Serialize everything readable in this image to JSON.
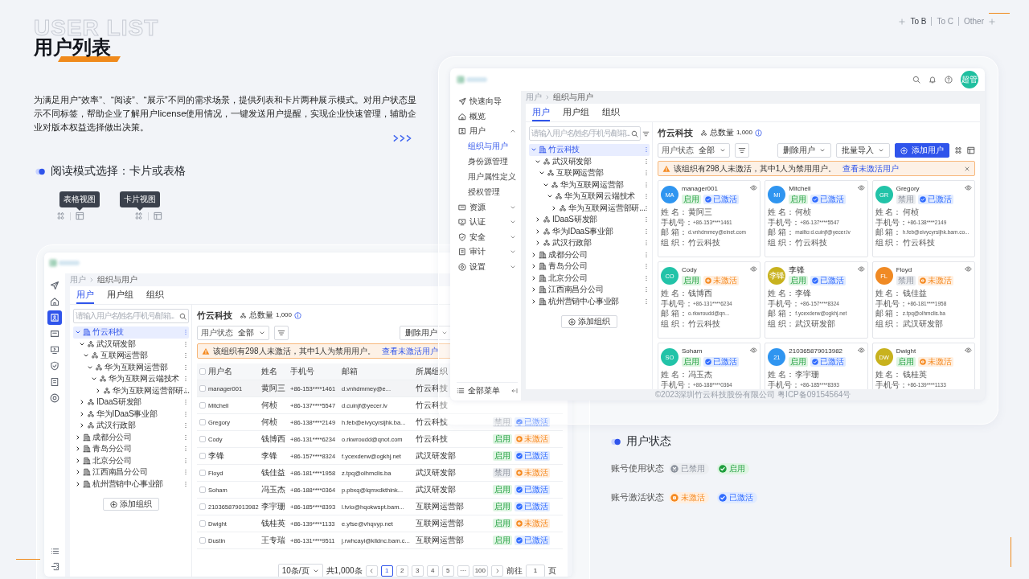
{
  "intro": {
    "title_en": "USER LIST",
    "title": "用户列表",
    "description": "为满足用户“效率”、“阅读”、“展示”不同的需求场景，提供列表和卡片两种展示模式。对用户状态显示不同标签，帮助企业了解用户license使用情况，一键发送用户提醒，实现企业快速管理，辅助企业对版本权益选择做出决策。",
    "nav": [
      {
        "label": "To B",
        "selected": true
      },
      {
        "label": "To C",
        "selected": false
      },
      {
        "label": "Other",
        "selected": false
      }
    ]
  },
  "reading_mode": {
    "heading": "阅读模式选择：卡片或表格",
    "demos": [
      {
        "tooltip": "表格视图",
        "kind": "table"
      },
      {
        "tooltip": "卡片视图",
        "kind": "grid"
      }
    ]
  },
  "table_app": {
    "rail": [
      {
        "selected": false
      },
      {
        "selected": false
      },
      {
        "selected": true
      },
      {
        "selected": false
      },
      {
        "selected": false
      },
      {
        "selected": false
      },
      {
        "selected": false
      },
      {
        "selected": false
      }
    ],
    "breadcrumb": [
      "用户",
      "组织与用户"
    ],
    "tabs": [
      {
        "label": "用户",
        "selected": true
      },
      {
        "label": "用户组",
        "selected": false
      },
      {
        "label": "组织",
        "selected": false
      }
    ],
    "search": {
      "placeholder": "请输入用户名/姓名/手机号/邮箱..."
    },
    "tree": [
      {
        "label": "竹云科技",
        "kind": "company",
        "expanded": true,
        "selected": true,
        "children": [
          {
            "label": "武汉研发部",
            "kind": "dept",
            "expanded": true,
            "selected": false,
            "children": [
              {
                "label": "互联网运营部",
                "kind": "dept",
                "expanded": true,
                "selected": false,
                "children": [
                  {
                    "label": "华为互联网运营部",
                    "kind": "dept",
                    "expanded": true,
                    "selected": false,
                    "children": [
                      {
                        "label": "华为互联网云端技术",
                        "kind": "dept",
                        "expanded": true,
                        "selected": false,
                        "children": [
                          {
                            "label": "华为互联网运营部研...",
                            "kind": "dept",
                            "expanded": false,
                            "selected": false
                          }
                        ]
                      }
                    ]
                  }
                ]
              }
            ]
          },
          {
            "label": "IDaaS研发部",
            "kind": "dept",
            "expanded": false,
            "selected": false
          },
          {
            "label": "华为IDaaS事业部",
            "kind": "dept",
            "expanded": false,
            "selected": false
          },
          {
            "label": "武汉行政部",
            "kind": "dept",
            "expanded": false,
            "selected": false
          }
        ]
      },
      {
        "label": "成都分公司",
        "kind": "company",
        "expanded": false,
        "selected": false
      },
      {
        "label": "青岛分公司",
        "kind": "company",
        "expanded": false,
        "selected": false
      },
      {
        "label": "北京分公司",
        "kind": "company",
        "expanded": false,
        "selected": false
      },
      {
        "label": "江西南昌分公司",
        "kind": "company",
        "expanded": false,
        "selected": false
      },
      {
        "label": "杭州营销中心事业部",
        "kind": "company",
        "expanded": false,
        "selected": false
      }
    ],
    "add_org": "添加组织",
    "org_title": "竹云科技",
    "count_label": "总数量",
    "count": "1,000",
    "filter": {
      "label": "用户状态",
      "value": "全部"
    },
    "buttons": [
      {
        "label": "删除用户",
        "kind": "dropdown"
      }
    ],
    "alert": {
      "text": "该组织有298人未激活，其中1人为禁用用户。",
      "link": "查看未激活用户"
    },
    "columns": [
      "用户名",
      "姓名",
      "手机号",
      "邮箱",
      "所属组织"
    ],
    "header_checked": false,
    "rows": [
      {
        "checked": false,
        "highlighted": true,
        "cells": [
          "manager001",
          "黄阿三",
          "+86-153****1461",
          "d.vnhdmmey@e...",
          "竹云科技"
        ]
      },
      {
        "checked": false,
        "highlighted": false,
        "cells": [
          "Mitchell",
          "何桢",
          "+86-137****5547",
          "d.cuinjf@yecer.lv",
          "竹云科技"
        ]
      },
      {
        "checked": false,
        "highlighted": false,
        "cells": [
          "Gregory",
          "何桢",
          "+86-138****2149",
          "h.feb@eivycyrsijhk.ba...",
          "竹云科技"
        ],
        "tags": [
          {
            "kind": "disabled",
            "label": "禁用"
          },
          {
            "kind": "active",
            "label": "已激活"
          }
        ]
      },
      {
        "checked": false,
        "highlighted": false,
        "cells": [
          "Cody",
          "钱博西",
          "+86-131****6234",
          "o.rkwroudd@qnot.com",
          "竹云科技"
        ],
        "tags": [
          {
            "kind": "enabled",
            "label": "启用"
          },
          {
            "kind": "inactive",
            "label": "未激活"
          }
        ]
      },
      {
        "checked": false,
        "highlighted": false,
        "cells": [
          "李锋",
          "李锋",
          "+86-157****8324",
          "f.ycexderw@ogkhj.net",
          "武汉研发部"
        ],
        "tags": [
          {
            "kind": "enabled",
            "label": "启用"
          },
          {
            "kind": "active",
            "label": "已激活"
          }
        ]
      },
      {
        "checked": false,
        "highlighted": false,
        "cells": [
          "Floyd",
          "钱佳益",
          "+86-181****1958",
          "z.tpq@olhmclis.ba",
          "武汉研发部"
        ],
        "tags": [
          {
            "kind": "disabled",
            "label": "禁用"
          },
          {
            "kind": "inactive",
            "label": "未激活"
          }
        ]
      },
      {
        "checked": false,
        "highlighted": false,
        "cells": [
          "Soham",
          "冯玉杰",
          "+86-188****0364",
          "p.pbxq@lqmxdkthink...",
          "武汉研发部"
        ],
        "tags": [
          {
            "kind": "enabled",
            "label": "启用"
          },
          {
            "kind": "active",
            "label": "已激活"
          }
        ]
      },
      {
        "checked": false,
        "highlighted": false,
        "cells": [
          "210365879013982",
          "李宇珊",
          "+86-185****8393",
          "l.tvio@hqokwspt.bam...",
          "互联网运营部"
        ],
        "tags": [
          {
            "kind": "enabled",
            "label": "启用"
          },
          {
            "kind": "active",
            "label": "已激活"
          }
        ]
      },
      {
        "checked": false,
        "highlighted": false,
        "cells": [
          "Dwight",
          "钱桂英",
          "+86-139****1133",
          "e.yfse@vhqvyp.net",
          "互联网运营部"
        ],
        "tags": [
          {
            "kind": "enabled",
            "label": "启用"
          },
          {
            "kind": "inactive",
            "label": "未激活"
          }
        ]
      },
      {
        "checked": false,
        "highlighted": false,
        "cells": [
          "Dustin",
          "王专瑞",
          "+86-131****9511",
          "j.rwhcayi@klldnc.bam.c...",
          "互联网运营部"
        ],
        "tags": [
          {
            "kind": "enabled",
            "label": "启用"
          },
          {
            "kind": "active",
            "label": "已激活"
          }
        ]
      }
    ],
    "pagination": {
      "page_size": "10条/页",
      "total": "共1,000条",
      "pages": [
        {
          "label": "1",
          "selected": true
        },
        {
          "label": "2",
          "selected": false
        },
        {
          "label": "3",
          "selected": false
        },
        {
          "label": "4",
          "selected": false
        },
        {
          "label": "5",
          "selected": false
        },
        {
          "label": "···",
          "selected": false
        },
        {
          "label": "100",
          "selected": false
        }
      ],
      "goto_label": "前往",
      "goto_value": "1",
      "goto_unit": "页"
    }
  },
  "card_app": {
    "avatar": "超管",
    "sidebar": {
      "items": [
        {
          "label": "快速向导",
          "selected": false
        },
        {
          "label": "概览",
          "selected": false
        },
        {
          "label": "用户",
          "selected": false,
          "expanded": true,
          "children": [
            {
              "label": "组织与用户",
              "selected": true
            },
            {
              "label": "身份源管理",
              "selected": false
            },
            {
              "label": "用户属性定义",
              "selected": false
            },
            {
              "label": "授权管理",
              "selected": false
            }
          ]
        },
        {
          "label": "资源",
          "selected": false,
          "expanded": false
        },
        {
          "label": "认证",
          "selected": false,
          "expanded": false
        },
        {
          "label": "安全",
          "selected": false,
          "expanded": false
        },
        {
          "label": "审计",
          "selected": false,
          "expanded": false
        },
        {
          "label": "设置",
          "selected": false,
          "expanded": false
        }
      ],
      "footer": "全部菜单"
    },
    "breadcrumb": [
      "用户",
      "组织与用户"
    ],
    "tabs": [
      {
        "label": "用户",
        "selected": true
      },
      {
        "label": "用户组",
        "selected": false
      },
      {
        "label": "组织",
        "selected": false
      }
    ],
    "search": {
      "placeholder": "请输入用户名/姓名/手机号/邮箱..."
    },
    "tree": [
      {
        "label": "竹云科技",
        "kind": "company",
        "expanded": true,
        "selected": true,
        "children": [
          {
            "label": "武汉研发部",
            "kind": "dept",
            "expanded": true,
            "selected": false,
            "children": [
              {
                "label": "互联网运营部",
                "kind": "dept",
                "expanded": true,
                "selected": false,
                "children": [
                  {
                    "label": "华为互联网运营部",
                    "kind": "dept",
                    "expanded": true,
                    "selected": false,
                    "children": [
                      {
                        "label": "华为互联网云端技术",
                        "kind": "dept",
                        "expanded": true,
                        "selected": false,
                        "children": [
                          {
                            "label": "华为互联网运营部研...",
                            "kind": "dept",
                            "expanded": false,
                            "selected": false
                          }
                        ]
                      }
                    ]
                  }
                ]
              }
            ]
          },
          {
            "label": "IDaaS研发部",
            "kind": "dept",
            "expanded": false,
            "selected": false
          },
          {
            "label": "华为IDaaS事业部",
            "kind": "dept",
            "expanded": false,
            "selected": false
          },
          {
            "label": "武汉行政部",
            "kind": "dept",
            "expanded": false,
            "selected": false
          }
        ]
      },
      {
        "label": "成都分公司",
        "kind": "company",
        "expanded": false,
        "selected": false
      },
      {
        "label": "青岛分公司",
        "kind": "company",
        "expanded": false,
        "selected": false
      },
      {
        "label": "北京分公司",
        "kind": "company",
        "expanded": false,
        "selected": false
      },
      {
        "label": "江西南昌分公司",
        "kind": "company",
        "expanded": false,
        "selected": false
      },
      {
        "label": "杭州营销中心事业部",
        "kind": "company",
        "expanded": false,
        "selected": false
      }
    ],
    "add_org": "添加组织",
    "org_title": "竹云科技",
    "count_label": "总数量",
    "count": "1,000",
    "filter": {
      "label": "用户状态",
      "value": "全部"
    },
    "buttons": [
      {
        "label": "删除用户",
        "kind": "dropdown"
      },
      {
        "label": "批量导入",
        "kind": "dropdown"
      },
      {
        "label": "添加用户",
        "kind": "primary"
      }
    ],
    "alert": {
      "text": "该组织有298人未激活，其中1人为禁用用户。",
      "link": "查看未激活用户",
      "closable": true
    },
    "cards": [
      {
        "initials": "MA",
        "color": "#2f95f0",
        "name": "manager001",
        "tags": [
          {
            "kind": "enabled",
            "label": "启用"
          },
          {
            "kind": "active",
            "label": "已激活"
          }
        ],
        "fields": [
          {
            "label": "姓 名：",
            "value": "黄阿三"
          },
          {
            "label": "手机号：",
            "value": "+86-153****1461"
          },
          {
            "label": "邮 箱：",
            "value": "d.vnhdmmey@einet.com"
          },
          {
            "label": "组 织：",
            "value": "竹云科技"
          }
        ]
      },
      {
        "initials": "MI",
        "color": "#2f95f0",
        "name": "Mitchell",
        "tags": [
          {
            "kind": "enabled",
            "label": "启用"
          },
          {
            "kind": "active",
            "label": "已激活"
          }
        ],
        "fields": [
          {
            "label": "姓 名：",
            "value": "何桢"
          },
          {
            "label": "手机号：",
            "value": "+86-137****5547"
          },
          {
            "label": "邮 箱：",
            "value": "mailto:d.cuinjf@yecer.lv"
          },
          {
            "label": "组 织：",
            "value": "竹云科技"
          }
        ]
      },
      {
        "initials": "GR",
        "color": "#22c3a8",
        "name": "Gregory",
        "tags": [
          {
            "kind": "disabled",
            "label": "禁用"
          },
          {
            "kind": "active",
            "label": "已激活"
          }
        ],
        "fields": [
          {
            "label": "姓 名：",
            "value": "何桢"
          },
          {
            "label": "手机号：",
            "value": "+86-138****2149"
          },
          {
            "label": "邮 箱：",
            "value": "h.feb@eivycyrsijhk.bam.co..."
          },
          {
            "label": "组 织：",
            "value": "竹云科技"
          }
        ]
      },
      {
        "initials": "CO",
        "color": "#22c3a8",
        "name": "Cody",
        "tags": [
          {
            "kind": "enabled",
            "label": "启用"
          },
          {
            "kind": "inactive",
            "label": "未激活"
          }
        ],
        "fields": [
          {
            "label": "姓 名：",
            "value": "钱博西"
          },
          {
            "label": "手机号：",
            "value": "+86-131****6234"
          },
          {
            "label": "邮 箱：",
            "value": "o.rkwroudd@qn..."
          },
          {
            "label": "组 织：",
            "value": "竹云科技"
          }
        ]
      },
      {
        "initials": "李锋",
        "color": "#c8b21e",
        "name": "李锋",
        "tags": [
          {
            "kind": "enabled",
            "label": "启用"
          },
          {
            "kind": "active",
            "label": "已激活"
          }
        ],
        "fields": [
          {
            "label": "姓 名：",
            "value": "李锋"
          },
          {
            "label": "手机号：",
            "value": "+86-157****8324"
          },
          {
            "label": "邮 箱：",
            "value": "f.ycexderw@ogkhj.net"
          },
          {
            "label": "组 织：",
            "value": "武汉研发部"
          }
        ]
      },
      {
        "initials": "FL",
        "color": "#f08a24",
        "name": "Floyd",
        "tags": [
          {
            "kind": "disabled",
            "label": "禁用"
          },
          {
            "kind": "inactive",
            "label": "未激活"
          }
        ],
        "fields": [
          {
            "label": "姓 名：",
            "value": "钱佳益"
          },
          {
            "label": "手机号：",
            "value": "+86-181****1958"
          },
          {
            "label": "邮 箱：",
            "value": "z.tpq@olhmclis.ba"
          },
          {
            "label": "组 织：",
            "value": "武汉研发部"
          }
        ]
      },
      {
        "initials": "SO",
        "color": "#22c3a8",
        "name": "Soham",
        "tags": [
          {
            "kind": "enabled",
            "label": "启用"
          },
          {
            "kind": "active",
            "label": "已激活"
          }
        ],
        "fields": [
          {
            "label": "姓 名：",
            "value": "冯玉杰"
          },
          {
            "label": "手机号：",
            "value": "+86-188****0364"
          }
        ]
      },
      {
        "initials": "21",
        "color": "#2f95f0",
        "name": "210365879013982",
        "tags": [
          {
            "kind": "enabled",
            "label": "启用"
          },
          {
            "kind": "active",
            "label": "已激活"
          }
        ],
        "fields": [
          {
            "label": "姓 名：",
            "value": "李宇珊"
          },
          {
            "label": "手机号：",
            "value": "+86-185****8393"
          }
        ]
      },
      {
        "initials": "DW",
        "color": "#c8b21e",
        "name": "Dwight",
        "tags": [
          {
            "kind": "enabled",
            "label": "启用"
          },
          {
            "kind": "inactive",
            "label": "未激活"
          }
        ],
        "fields": [
          {
            "label": "姓 名：",
            "value": "钱桂英"
          },
          {
            "label": "手机号：",
            "value": "+86-139****1133"
          }
        ]
      }
    ],
    "footer": "©2023深圳竹云科技股份有限公司 粤ICP备09154564号"
  },
  "status_legend": {
    "heading": "用户状态",
    "rows": [
      {
        "label": "账号使用状态",
        "tags": [
          {
            "kind": "disabled",
            "label": "已禁用"
          },
          {
            "kind": "enabled",
            "label": "启用"
          }
        ]
      },
      {
        "label": "账号激活状态",
        "tags": [
          {
            "kind": "inactive",
            "label": "未激活"
          },
          {
            "kind": "active",
            "label": "已激活"
          }
        ]
      }
    ]
  }
}
